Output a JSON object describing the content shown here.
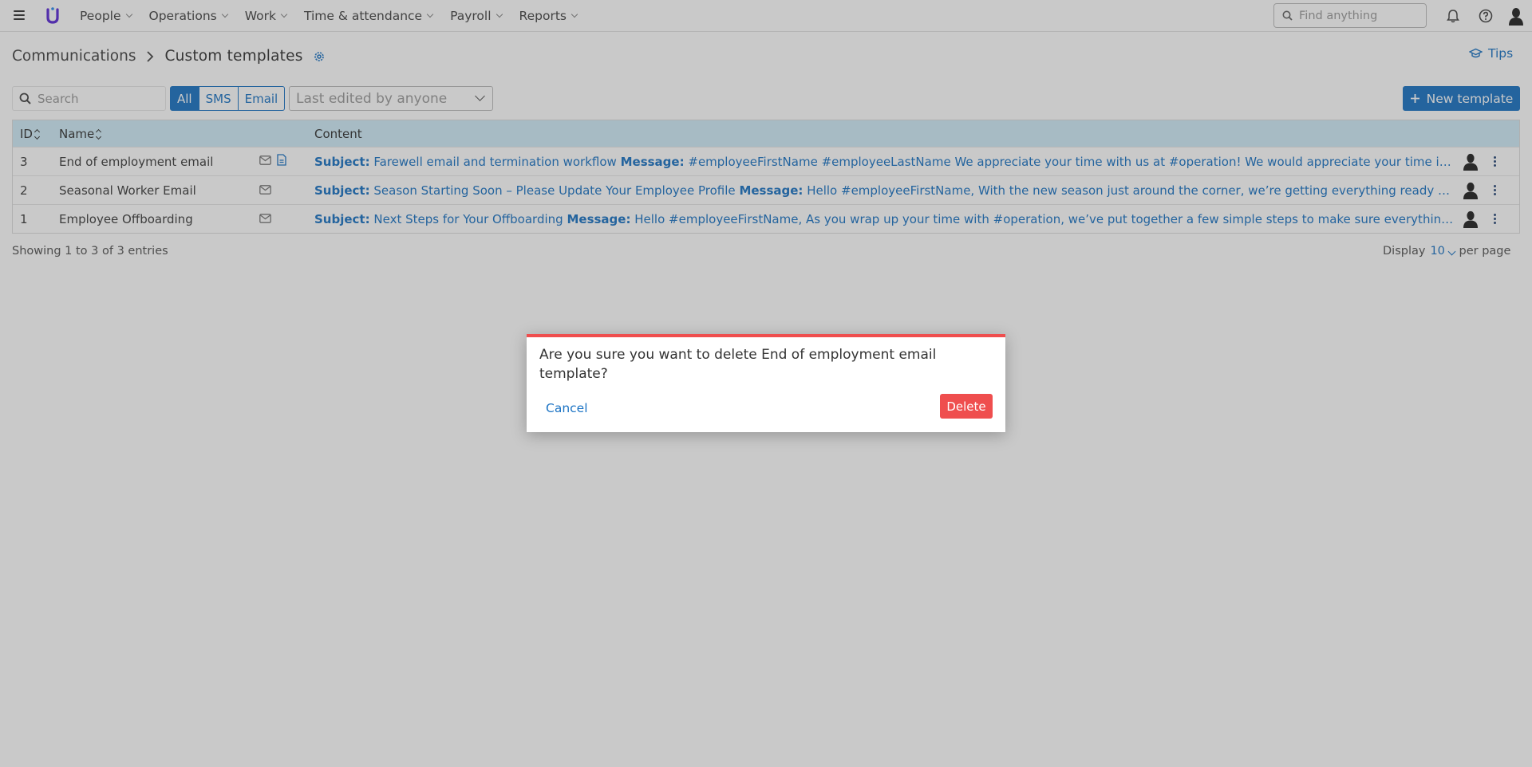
{
  "nav": {
    "menu": [
      {
        "label": "People"
      },
      {
        "label": "Operations"
      },
      {
        "label": "Work"
      },
      {
        "label": "Time & attendance"
      },
      {
        "label": "Payroll"
      },
      {
        "label": "Reports"
      }
    ],
    "search_placeholder": "Find anything"
  },
  "breadcrumb": {
    "parent": "Communications",
    "current": "Custom templates"
  },
  "tips_label": "Tips",
  "filters": {
    "search_placeholder": "Search",
    "types": [
      "All",
      "SMS",
      "Email"
    ],
    "selected_type": "All",
    "edited_by_placeholder": "Last edited by anyone"
  },
  "new_template_label": "New template",
  "table": {
    "columns": {
      "id": "ID",
      "name": "Name",
      "content": "Content"
    },
    "rows": [
      {
        "id": "3",
        "name": "End of employment email",
        "icons": [
          "email-icon",
          "document-icon"
        ],
        "subject_label": "Subject:",
        "subject": "Farewell email and termination workflow",
        "message_label": "Message:",
        "message": "#employeeFirstName #employeeLastName We appreciate your time with us at #operation! We would appreciate your time in c..."
      },
      {
        "id": "2",
        "name": "Seasonal Worker Email",
        "icons": [
          "email-icon"
        ],
        "subject_label": "Subject:",
        "subject": "Season Starting Soon – Please Update Your Employee Profile",
        "message_label": "Message:",
        "message": "Hello #employeeFirstName, With the new season just around the corner, we’re getting everything ready for ..."
      },
      {
        "id": "1",
        "name": "Employee Offboarding",
        "icons": [
          "email-icon"
        ],
        "subject_label": "Subject:",
        "subject": "Next Steps for Your Offboarding",
        "message_label": "Message:",
        "message": "Hello #employeeFirstName, As you wrap up your time with #operation, we’ve put together a few simple steps to make sure everything is ..."
      }
    ]
  },
  "footer": {
    "showing": "Showing 1 to 3 of 3 entries",
    "display_label": "Display",
    "per_page_value": "10",
    "per_page_label": "per page"
  },
  "dialog": {
    "question": "Are you sure you want to delete End of employment email template?",
    "cancel_label": "Cancel",
    "delete_label": "Delete"
  },
  "colors": {
    "accent": "#1b73c4",
    "danger": "#ef4e4e",
    "table_header": "#d0ecf8",
    "brand": "#5b2ad6"
  }
}
